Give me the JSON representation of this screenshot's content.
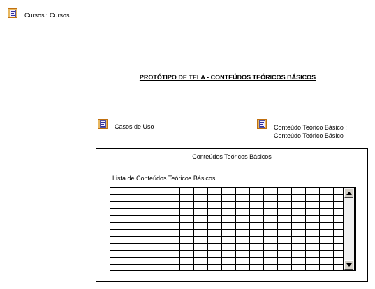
{
  "header": {
    "link_label": "Cursos : Cursos"
  },
  "page_title": "PROTÓTIPO DE TELA - CONTEÚDOS TEÓRICOS BÁSICOS",
  "links": {
    "use_cases": "Casos de Uso",
    "detail_line1": "Conteúdo Teórico Básico :",
    "detail_line2": "Conteúdo Teórico Básico"
  },
  "window": {
    "title": "Conteúdos Teóricos Básicos",
    "list_label": "Lista de Conteúdos Teóricos Básicos"
  },
  "icons": {
    "diagram_link": "diagram-link-icon",
    "scroll_up": "arrow-up-icon",
    "scroll_down": "arrow-down-icon"
  },
  "colors": {
    "icon_fill": "#e8b860",
    "icon_border": "#c07010"
  }
}
